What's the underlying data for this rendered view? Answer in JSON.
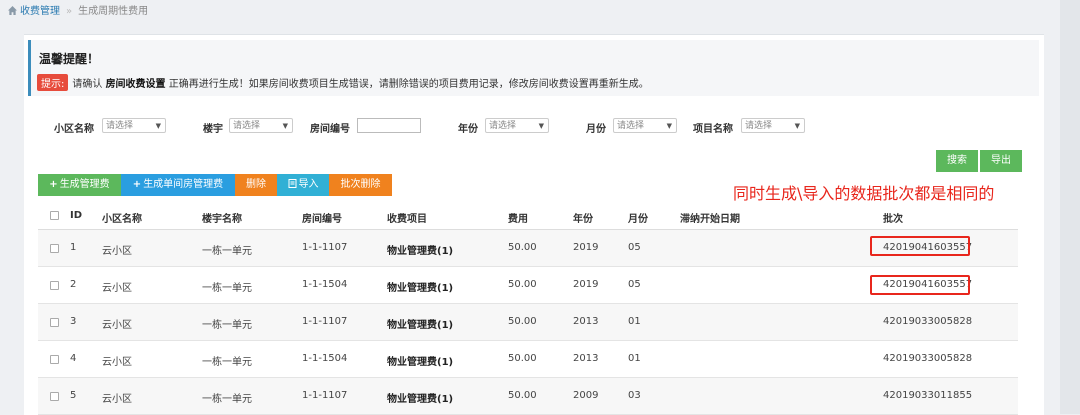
{
  "breadcrumb": {
    "home": "收费管理",
    "current": "生成周期性费用"
  },
  "notice": {
    "title": "温馨提醒！",
    "badge": "提示:",
    "text_before": "请确认",
    "bold": "房间收费设置",
    "text_after": "正确再进行生成！如果房间收费项目生成错误，请删除错误的项目费用记录，修改房间收费设置再重新生成。"
  },
  "filters": {
    "community_label": "小区名称",
    "community_value": "请选择",
    "building_label": "楼宇",
    "building_value": "请选择",
    "room_label": "房间编号",
    "room_value": "",
    "year_label": "年份",
    "year_value": "请选择",
    "month_label": "月份",
    "month_value": "请选择",
    "item_label": "项目名称",
    "item_value": "请选择"
  },
  "actions": {
    "search": "搜索",
    "export": "导出",
    "gen_mgmt_fee": "生成管理费",
    "gen_single_fee": "生成单间房管理费",
    "delete": "删除",
    "import": "导入",
    "batch_delete": "批次删除"
  },
  "annotation": "同时生成\\导入的数据批次都是相同的",
  "table": {
    "headers": [
      "ID",
      "小区名称",
      "楼宇名称",
      "房间编号",
      "收费项目",
      "费用",
      "年份",
      "月份",
      "滞纳开始日期",
      "批次"
    ],
    "rows": [
      {
        "id": "1",
        "community": "云小区",
        "building": "一栋一单元",
        "room": "1-1-1107",
        "item": "物业管理费(1)",
        "fee": "50.00",
        "year": "2019",
        "month": "05",
        "late": "",
        "batch": "42019041603557"
      },
      {
        "id": "2",
        "community": "云小区",
        "building": "一栋一单元",
        "room": "1-1-1504",
        "item": "物业管理费(1)",
        "fee": "50.00",
        "year": "2019",
        "month": "05",
        "late": "",
        "batch": "42019041603557"
      },
      {
        "id": "3",
        "community": "云小区",
        "building": "一栋一单元",
        "room": "1-1-1107",
        "item": "物业管理费(1)",
        "fee": "50.00",
        "year": "2013",
        "month": "01",
        "late": "",
        "batch": "42019033005828"
      },
      {
        "id": "4",
        "community": "云小区",
        "building": "一栋一单元",
        "room": "1-1-1504",
        "item": "物业管理费(1)",
        "fee": "50.00",
        "year": "2013",
        "month": "01",
        "late": "",
        "batch": "42019033005828"
      },
      {
        "id": "5",
        "community": "云小区",
        "building": "一栋一单元",
        "room": "1-1-1107",
        "item": "物业管理费(1)",
        "fee": "50.00",
        "year": "2009",
        "month": "03",
        "late": "",
        "batch": "42019033011855"
      }
    ]
  },
  "colors": {
    "accent": "#3c8dbc",
    "green": "#5cb85c",
    "blue": "#2a9ee0",
    "orange": "#f0821e",
    "annotation_red": "#e8261c"
  }
}
